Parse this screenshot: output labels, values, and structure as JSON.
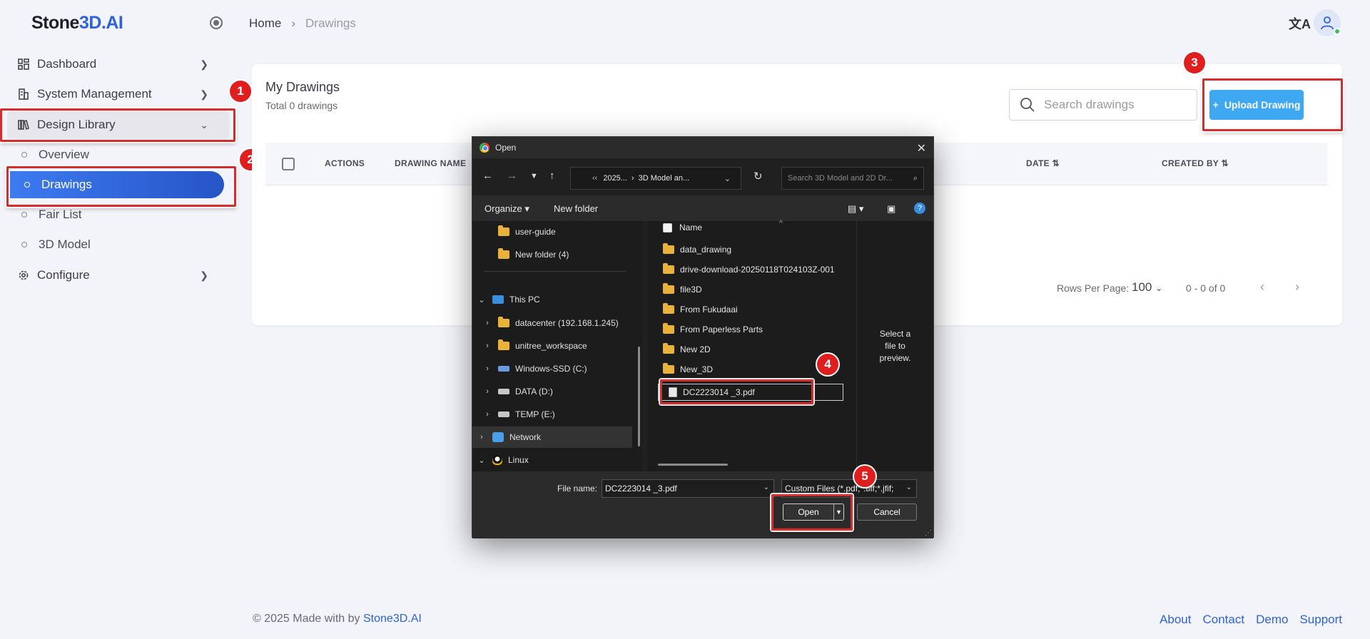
{
  "app": {
    "logo_prefix": "Stone",
    "logo_brand": "3D.AI"
  },
  "sidebar": {
    "items": [
      {
        "label": "Dashboard",
        "icon": "grid-icon"
      },
      {
        "label": "System Management",
        "icon": "building-icon"
      },
      {
        "label": "Design Library",
        "icon": "library-icon"
      },
      {
        "label": "Configure",
        "icon": "gear-icon"
      }
    ],
    "sub_items": [
      {
        "label": "Overview"
      },
      {
        "label": "Drawings"
      },
      {
        "label": "Fair List"
      },
      {
        "label": "3D Model"
      }
    ]
  },
  "header": {
    "breadcrumb_home": "Home",
    "breadcrumb_current": "Drawings"
  },
  "main": {
    "title": "My Drawings",
    "subtitle": "Total 0 drawings",
    "search_placeholder": "Search drawings",
    "upload_label": "Upload Drawing",
    "columns": [
      "ACTIONS",
      "DRAWING NAME",
      "DATE",
      "CREATED BY"
    ],
    "rows_per_page_label": "Rows Per Page:",
    "rows_per_page": "100",
    "page_range": "0 - 0 of 0"
  },
  "footer": {
    "copyright": "© 2025 Made with by",
    "brand": "Stone3D.AI",
    "links": [
      "About",
      "Contact",
      "Demo",
      "Support"
    ]
  },
  "annotations": {
    "badges": [
      "1",
      "2",
      "3",
      "4",
      "5"
    ],
    "color": "#d62c2c"
  },
  "dialog": {
    "title": "Open",
    "address_parts": [
      "‹‹",
      "2025...",
      "›",
      "3D Model an..."
    ],
    "search_placeholder": "Search 3D Model and 2D Dr...",
    "organize": "Organize ▾",
    "new_folder": "New folder",
    "tree": [
      {
        "label": "user-guide",
        "type": "folder"
      },
      {
        "label": "New folder (4)",
        "type": "folder"
      },
      {
        "label": "This PC",
        "type": "pc"
      },
      {
        "label": "datacenter (192.168.1.245)",
        "type": "netfolder"
      },
      {
        "label": "unitree_workspace",
        "type": "netfolder"
      },
      {
        "label": "Windows-SSD (C:)",
        "type": "drive"
      },
      {
        "label": "DATA (D:)",
        "type": "drive"
      },
      {
        "label": "TEMP (E:)",
        "type": "drive"
      },
      {
        "label": "Network",
        "type": "network"
      },
      {
        "label": "Linux",
        "type": "linux"
      }
    ],
    "name_header": "Name",
    "files": [
      {
        "label": "data_drawing"
      },
      {
        "label": "drive-download-20250118T024103Z-001"
      },
      {
        "label": "file3D"
      },
      {
        "label": "From Fukudaai"
      },
      {
        "label": "From Paperless  Parts"
      },
      {
        "label": "New 2D"
      },
      {
        "label": "New_3D"
      },
      {
        "label": "DC2223014 _3.pdf"
      }
    ],
    "preview_text": "Select a file to preview.",
    "file_name_label": "File name:",
    "file_name_value": "DC2223014 _3.pdf",
    "file_type": "Custom Files (*.pdf;*.tiff;*.jfif;",
    "open_label": "Open",
    "cancel_label": "Cancel"
  }
}
